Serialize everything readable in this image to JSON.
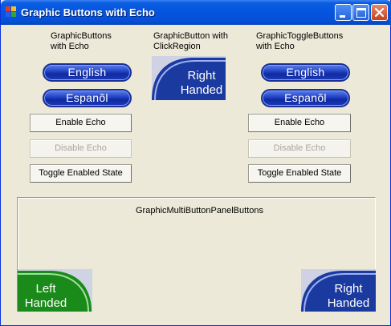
{
  "window": {
    "title": "Graphic Buttons with Echo"
  },
  "left": {
    "heading": "GraphicButtons\nwith Echo",
    "btn_english": "English",
    "btn_spanish": "Espanõl",
    "enable_echo": "Enable Echo",
    "disable_echo": "Disable Echo",
    "toggle_enabled": "Toggle Enabled State"
  },
  "center": {
    "heading": "GraphicButton with\nClickRegion",
    "right_handed": "Right\nHanded"
  },
  "right": {
    "heading": "GraphicToggleButtons\nwith Echo",
    "btn_english": "English",
    "btn_spanish": "Espanõl",
    "enable_echo": "Enable Echo",
    "disable_echo": "Disable Echo",
    "toggle_enabled": "Toggle Enabled State"
  },
  "panel": {
    "title": "GraphicMultiButtonPanelButtons",
    "left_handed": "Left\nHanded",
    "right_handed": "Right\nHanded"
  },
  "colors": {
    "title_bar": "#0554df",
    "button_blue": "#1c3bb8",
    "left_handed_green": "#1a8a1a",
    "right_handed_blue": "#1b3aa0",
    "disabled_text": "#a9a79c"
  }
}
